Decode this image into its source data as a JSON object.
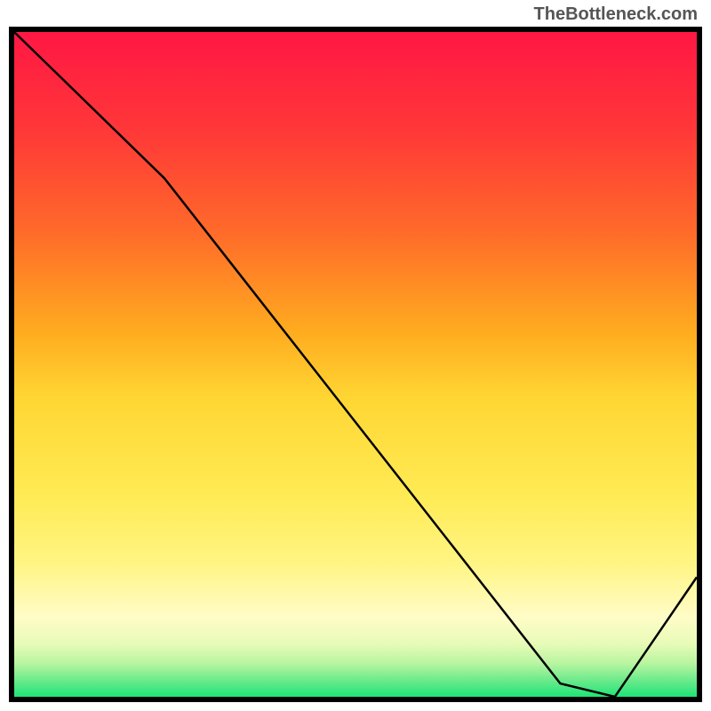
{
  "watermark": "TheBottleneck.com",
  "chart_data": {
    "type": "line",
    "title": "",
    "xlabel": "",
    "ylabel": "",
    "xlim": [
      0,
      100
    ],
    "ylim": [
      0,
      100
    ],
    "x": [
      0,
      22,
      80,
      88,
      100
    ],
    "y": [
      100,
      78,
      2,
      0,
      18
    ],
    "series": [
      {
        "name": "curve",
        "x": [
          0,
          22,
          80,
          88,
          100
        ],
        "y": [
          100,
          78,
          2,
          0,
          18
        ]
      }
    ],
    "gradient_bands": [
      {
        "position": 0.0,
        "color": "#ff1744"
      },
      {
        "position": 0.15,
        "color": "#ff3838"
      },
      {
        "position": 0.3,
        "color": "#ff6a2a"
      },
      {
        "position": 0.45,
        "color": "#ffab1f"
      },
      {
        "position": 0.55,
        "color": "#ffd633"
      },
      {
        "position": 0.7,
        "color": "#ffeb55"
      },
      {
        "position": 0.8,
        "color": "#fff584"
      },
      {
        "position": 0.88,
        "color": "#fffcc7"
      },
      {
        "position": 0.92,
        "color": "#e8fbb8"
      },
      {
        "position": 0.95,
        "color": "#b8f5a0"
      },
      {
        "position": 0.98,
        "color": "#5de888"
      },
      {
        "position": 1.0,
        "color": "#1de676"
      }
    ],
    "bottom_label": {
      "text": "",
      "color": "#ff3333",
      "x_fraction": 0.78
    }
  }
}
